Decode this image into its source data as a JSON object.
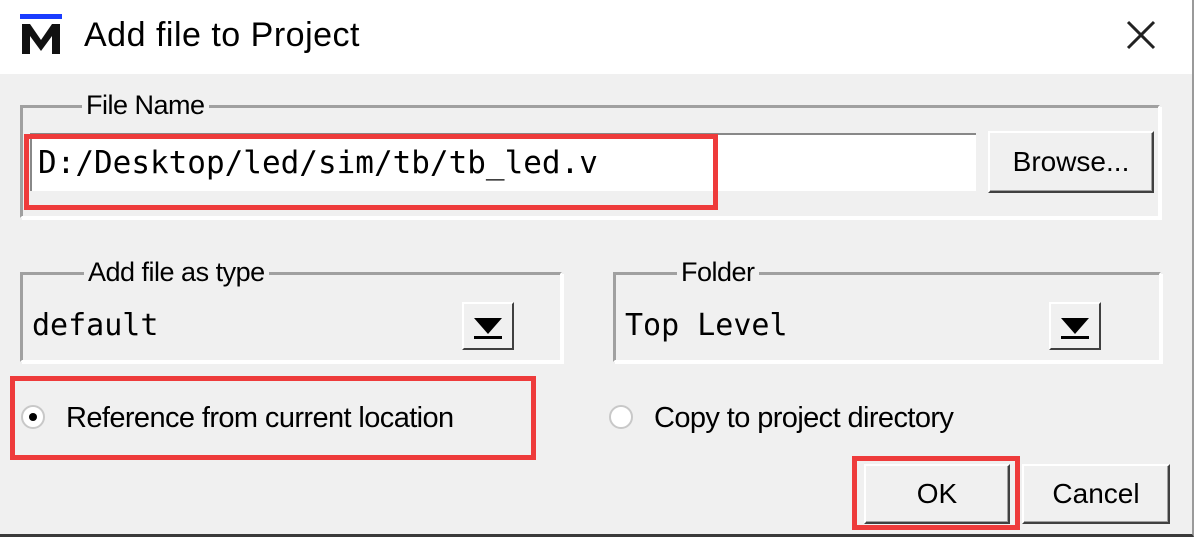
{
  "window": {
    "title": "Add file to Project",
    "logo_glyph": "M",
    "close_icon": "close-icon"
  },
  "file_name": {
    "legend": "File Name",
    "value": "D:/Desktop/led/sim/tb/tb_led.v",
    "browse_label": "Browse..."
  },
  "file_type": {
    "legend": "Add file as type",
    "selected": "default"
  },
  "folder": {
    "legend": "Folder",
    "selected": "Top Level"
  },
  "options": {
    "reference_label": "Reference from current location",
    "reference_selected": true,
    "copy_label": "Copy to project directory",
    "copy_selected": false
  },
  "buttons": {
    "ok_label": "OK",
    "cancel_label": "Cancel"
  },
  "colors": {
    "dialog_bg": "#f0f0f0",
    "highlight": "#ee3b3b",
    "logo_blue": "#1a3cff"
  }
}
